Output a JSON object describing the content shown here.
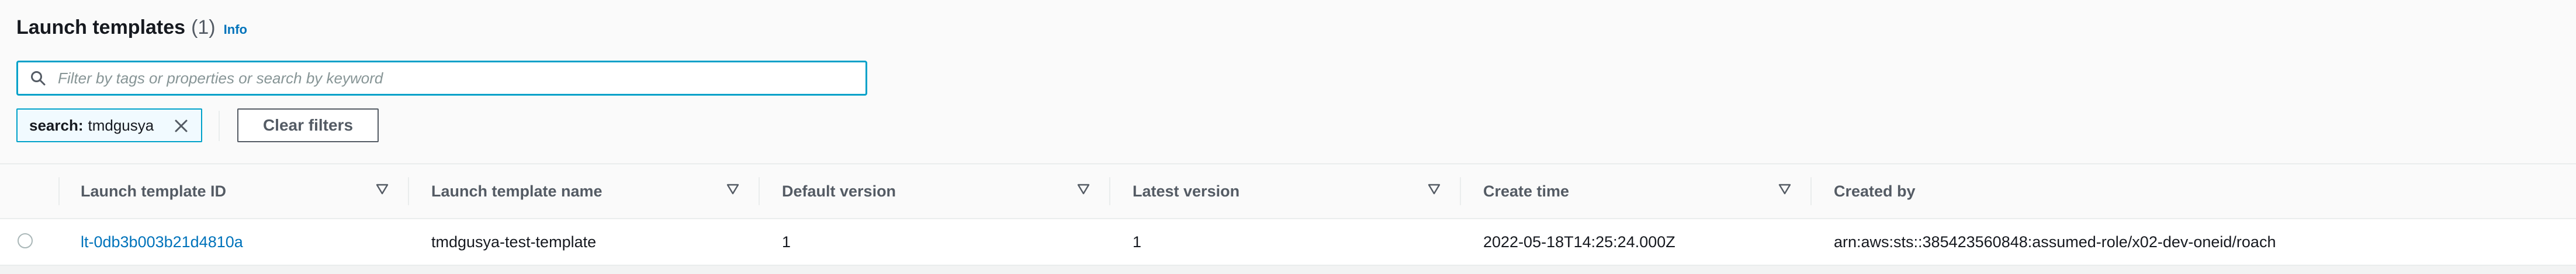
{
  "header": {
    "title": "Launch templates",
    "count": "(1)",
    "info_label": "Info"
  },
  "search": {
    "placeholder": "Filter by tags or properties or search by keyword",
    "value": ""
  },
  "filters": {
    "token_key": "search:",
    "token_value": "tmdgusya",
    "clear_label": "Clear filters"
  },
  "table": {
    "columns": [
      "Launch template ID",
      "Launch template name",
      "Default version",
      "Latest version",
      "Create time",
      "Created by"
    ],
    "rows": [
      {
        "id": "lt-0db3b003b21d4810a",
        "name": "tmdgusya-test-template",
        "default_version": "1",
        "latest_version": "1",
        "create_time": "2022-05-18T14:25:24.000Z",
        "created_by": "arn:aws:sts::385423560848:assumed-role/x02-dev-oneid/roach"
      }
    ]
  },
  "icons": {
    "search": "search-icon",
    "token_close": "close-icon",
    "sort": "sort-caret-down-icon"
  },
  "colors": {
    "accent": "#0073bb",
    "focus_border": "#00a1c9",
    "header_text": "#545b64"
  }
}
